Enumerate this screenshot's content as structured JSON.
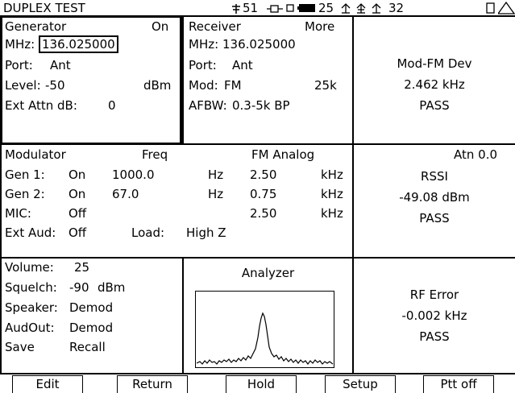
{
  "header": {
    "title": "DUPLEX TEST",
    "tx_count": "51",
    "battery_level": "25",
    "right_value": "32"
  },
  "generator": {
    "title": "Generator",
    "status": "On",
    "mhz_label": "MHz:",
    "mhz_value": "136.025000",
    "port_label": "Port:",
    "port_value": "Ant",
    "level_label": "Level:",
    "level_value": "-50",
    "level_unit": "dBm",
    "ext_attn_label": "Ext Attn dB:",
    "ext_attn_value": "0"
  },
  "receiver": {
    "title": "Receiver",
    "more": "More",
    "mhz_label": "MHz:",
    "mhz_value": "136.025000",
    "port_label": "Port:",
    "port_value": "Ant",
    "mod_label": "Mod:",
    "mod_value": "FM",
    "bw": "25k",
    "afbw_label": "AFBW:",
    "afbw_value": "0.3-5k BP"
  },
  "mod_fm_dev": {
    "title": "Mod-FM Dev",
    "value": "2.462 kHz",
    "result": "PASS"
  },
  "modulator": {
    "title": "Modulator",
    "freq_header": "Freq",
    "mode": "FM Analog",
    "rows": [
      {
        "label": "Gen 1:",
        "state": "On",
        "freq": "1000.0",
        "freq_unit": "Hz",
        "dev": "2.50",
        "dev_unit": "kHz"
      },
      {
        "label": "Gen 2:",
        "state": "On",
        "freq": "67.0",
        "freq_unit": "Hz",
        "dev": "0.75",
        "dev_unit": "kHz"
      },
      {
        "label": "MIC:",
        "state": "Off",
        "freq": "",
        "freq_unit": "",
        "dev": "2.50",
        "dev_unit": "kHz"
      }
    ],
    "ext_aud_label": "Ext Aud:",
    "ext_aud_value": "Off",
    "load_label": "Load:",
    "load_value": "High Z"
  },
  "rssi": {
    "atn": "Atn 0.0",
    "title": "RSSI",
    "value": "-49.08 dBm",
    "result": "PASS"
  },
  "audio": {
    "volume_label": "Volume:",
    "volume_value": "25",
    "squelch_label": "Squelch:",
    "squelch_value": "-90",
    "squelch_unit": "dBm",
    "speaker_label": "Speaker:",
    "speaker_value": "Demod",
    "audout_label": "AudOut:",
    "audout_value": "Demod",
    "save_label": "Save",
    "recall_label": "Recall"
  },
  "analyzer": {
    "title": "Analyzer"
  },
  "rf_error": {
    "title": "RF Error",
    "value": "-0.002 kHz",
    "result": "PASS"
  },
  "softkeys": [
    "Edit",
    "Return",
    "Hold",
    "Setup",
    "Ptt off"
  ]
}
